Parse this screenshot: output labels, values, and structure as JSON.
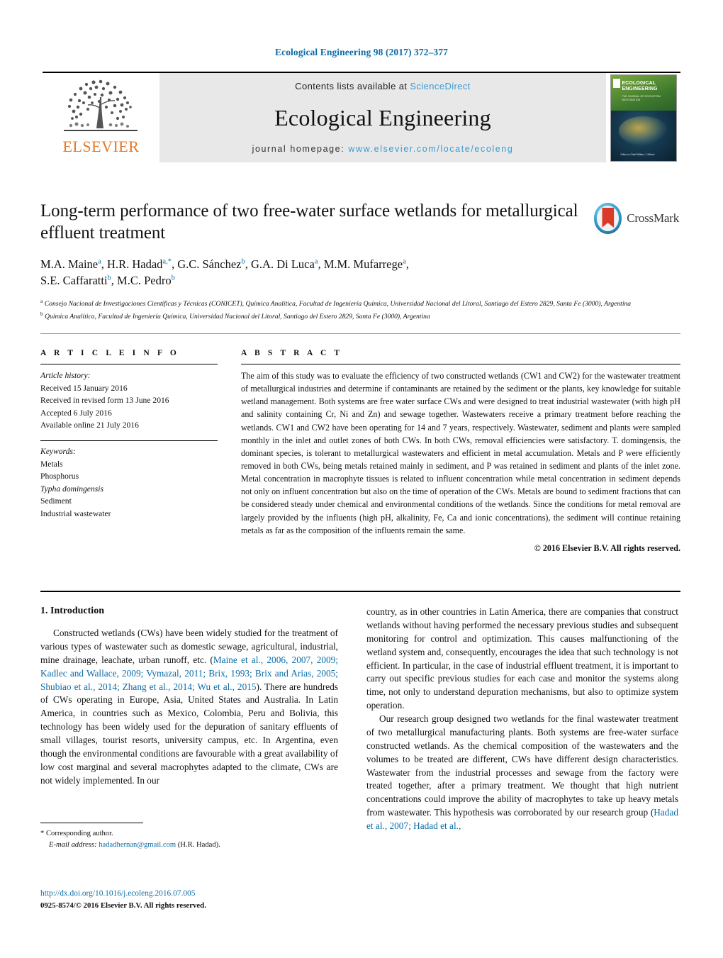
{
  "running_head": "Ecological Engineering 98 (2017) 372–377",
  "masthead": {
    "elsevier_wordmark": "ELSEVIER",
    "contents_prefix": "Contents lists available at ",
    "contents_link": "ScienceDirect",
    "journal_name": "Ecological Engineering",
    "homepage_prefix": "journal homepage: ",
    "homepage_url": "www.elsevier.com/locate/ecoleng",
    "cover": {
      "title_line1": "ECOLOGICAL",
      "title_line2": "ENGINEERING",
      "subtitle": "THE JOURNAL OF\nECOSYSTEM RESTORATION",
      "footer": "Editor-in-Chief\nWilliam J. Mitsch"
    }
  },
  "crossmark": {
    "label": "CrossMark"
  },
  "article": {
    "title": "Long-term performance of two free-water surface wetlands for metallurgical effluent treatment",
    "authors_line1": "M.A. Maine a, H.R. Hadad a,*, G.C. Sánchez b, G.A. Di Luca a, M.M. Mufarrege a,",
    "authors_line2": "S.E. Caffaratti b, M.C. Pedro b",
    "affiliation_a": "Consejo Nacional de Investigaciones Científicas y Técnicas (CONICET), Química Analítica, Facultad de Ingeniería Química, Universidad Nacional del Litoral, Santiago del Estero 2829, Santa Fe (3000), Argentina",
    "affiliation_b": "Química Analítica, Facultad de Ingeniería Química, Universidad Nacional del Litoral, Santiago del Estero 2829, Santa Fe (3000), Argentina"
  },
  "article_info": {
    "heading": "A R T I C L E   I N F O",
    "history_label": "Article history:",
    "history": [
      "Received 15 January 2016",
      "Received in revised form 13 June 2016",
      "Accepted 6 July 2016",
      "Available online 21 July 2016"
    ],
    "keywords_label": "Keywords:",
    "keywords": [
      "Metals",
      "Phosphorus",
      "Typha domingensis",
      "Sediment",
      "Industrial wastewater"
    ]
  },
  "abstract": {
    "heading": "A B S T R A C T",
    "text": "The aim of this study was to evaluate the efficiency of two constructed wetlands (CW1 and CW2) for the wastewater treatment of metallurgical industries and determine if contaminants are retained by the sediment or the plants, key knowledge for suitable wetland management. Both systems are free water surface CWs and were designed to treat industrial wastewater (with high pH and salinity containing Cr, Ni and Zn) and sewage together. Wastewaters receive a primary treatment before reaching the wetlands. CW1 and CW2 have been operating for 14 and 7 years, respectively. Wastewater, sediment and plants were sampled monthly in the inlet and outlet zones of both CWs. In both CWs, removal efficiencies were satisfactory. T. domingensis, the dominant species, is tolerant to metallurgical wastewaters and efficient in metal accumulation. Metals and P were efficiently removed in both CWs, being metals retained mainly in sediment, and P was retained in sediment and plants of the inlet zone. Metal concentration in macrophyte tissues is related to influent concentration while metal concentration in sediment depends not only on influent concentration but also on the time of operation of the CWs. Metals are bound to sediment fractions that can be considered steady under chemical and environmental conditions of the wetlands. Since the conditions for metal removal are largely provided by the influents (high pH, alkalinity, Fe, Ca and ionic concentrations), the sediment will continue retaining metals as far as the composition of the influents remain the same.",
    "copyright": "© 2016 Elsevier B.V. All rights reserved."
  },
  "body": {
    "section_heading": "1. Introduction",
    "left_para1_a": "Constructed wetlands (CWs) have been widely studied for the treatment of various types of wastewater such as domestic sewage, agricultural, industrial, mine drainage, leachate, urban runoff, etc. (",
    "left_para1_cite": "Maine et al., 2006, 2007, 2009; Kadlec and Wallace, 2009; Vymazal, 2011; Brix, 1993; Brix and Arias, 2005; Shubiao et al., 2014; Zhang et al., 2014; Wu et al., 2015",
    "left_para1_b": "). There are hundreds of CWs operating in Europe, Asia, United States and Australia. In Latin America, in countries such as Mexico, Colombia, Peru and Bolivia, this technology has been widely used for the depuration of sanitary effluents of small villages, tourist resorts, university campus, etc. In Argentina, even though the environmental conditions are favourable with a great availability of low cost marginal and several macrophytes adapted to the climate, CWs are not widely implemented. In our",
    "right_para1": "country, as in other countries in Latin America, there are companies that construct wetlands without having performed the necessary previous studies and subsequent monitoring for control and optimization. This causes malfunctioning of the wetland system and, consequently, encourages the idea that such technology is not efficient. In particular, in the case of industrial effluent treatment, it is important to carry out specific previous studies for each case and monitor the systems along time, not only to understand depuration mechanisms, but also to optimize system operation.",
    "right_para2_a": "Our research group designed two wetlands for the final wastewater treatment of two metallurgical manufacturing plants. Both systems are free-water surface constructed wetlands. As the chemical composition of the wastewaters and the volumes to be treated are different, CWs have different design characteristics. Wastewater from the industrial processes and sewage from the factory were treated together, after a primary treatment. We thought that high nutrient concentrations could improve the ability of macrophytes to take up heavy metals from wastewater. This hypothesis was corroborated by our research group (",
    "right_para2_cite": "Hadad et al., 2007; Hadad et al.,"
  },
  "footer": {
    "corresponding_marker": "*",
    "corresponding_label": "Corresponding author.",
    "email_label": "E-mail address:",
    "email": "hadadhernan@gmail.com",
    "email_owner": "(H.R. Hadad).",
    "doi_url": "http://dx.doi.org/10.1016/j.ecoleng.2016.07.005",
    "issn_line": "0925-8574/© 2016 Elsevier B.V. All rights reserved."
  },
  "colors": {
    "link_blue": "#0b6ca8",
    "sciencedirect_blue": "#3a9bd4",
    "elsevier_orange": "#e87722",
    "masthead_gray": "#e8e8e8",
    "crossmark_red": "#d93b28"
  }
}
